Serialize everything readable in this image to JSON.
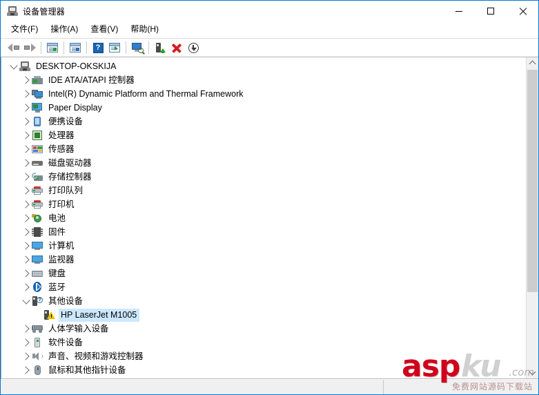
{
  "window": {
    "title": "设备管理器",
    "icon": "device-manager-icon",
    "border_color": "#0078d7",
    "caption": {
      "minimize": "—",
      "maximize": "□",
      "close": "✕"
    }
  },
  "menubar": {
    "items": [
      {
        "label": "文件(F)",
        "name": "menu-file"
      },
      {
        "label": "操作(A)",
        "name": "menu-action"
      },
      {
        "label": "查看(V)",
        "name": "menu-view"
      },
      {
        "label": "帮助(H)",
        "name": "menu-help"
      }
    ]
  },
  "toolbar": {
    "buttons": [
      {
        "name": "back-arrow-icon",
        "tip": "后退"
      },
      {
        "name": "forward-arrow-icon",
        "tip": "前进"
      },
      {
        "name": "show-hide-console-tree-icon",
        "tip": "显示/隐藏控制台树"
      },
      {
        "name": "properties-icon",
        "tip": "属性"
      },
      {
        "name": "help-icon",
        "tip": "帮助"
      },
      {
        "name": "action-menu-icon",
        "tip": "操作"
      },
      {
        "name": "scan-hardware-changes-icon",
        "tip": "扫描检测硬件改动"
      },
      {
        "name": "update-driver-icon",
        "tip": "更新驱动程序"
      },
      {
        "name": "uninstall-device-icon",
        "tip": "卸载设备"
      },
      {
        "name": "disable-device-icon",
        "tip": "禁用设备"
      }
    ]
  },
  "tree": {
    "root": {
      "label": "DESKTOP-OKSKIJA",
      "icon": "computer-icon",
      "expanded": true,
      "level": 0
    },
    "items": [
      {
        "label": "IDE ATA/ATAPI 控制器",
        "icon": "ide-controller-icon",
        "expanded": false,
        "level": 1,
        "selected": false
      },
      {
        "label": "Intel(R) Dynamic Platform and Thermal Framework",
        "icon": "intel-framework-icon",
        "expanded": false,
        "level": 1,
        "selected": false
      },
      {
        "label": "Paper Display",
        "icon": "display-adapter-icon",
        "expanded": false,
        "level": 1,
        "selected": false
      },
      {
        "label": "便携设备",
        "icon": "portable-device-icon",
        "expanded": false,
        "level": 1,
        "selected": false
      },
      {
        "label": "处理器",
        "icon": "processor-icon",
        "expanded": false,
        "level": 1,
        "selected": false
      },
      {
        "label": "传感器",
        "icon": "sensor-icon",
        "expanded": false,
        "level": 1,
        "selected": false
      },
      {
        "label": "磁盘驱动器",
        "icon": "disk-drive-icon",
        "expanded": false,
        "level": 1,
        "selected": false
      },
      {
        "label": "存储控制器",
        "icon": "storage-controller-icon",
        "expanded": false,
        "level": 1,
        "selected": false
      },
      {
        "label": "打印队列",
        "icon": "print-queue-icon",
        "expanded": false,
        "level": 1,
        "selected": false
      },
      {
        "label": "打印机",
        "icon": "printer-icon",
        "expanded": false,
        "level": 1,
        "selected": false
      },
      {
        "label": "电池",
        "icon": "battery-icon",
        "expanded": false,
        "level": 1,
        "selected": false
      },
      {
        "label": "固件",
        "icon": "firmware-icon",
        "expanded": false,
        "level": 1,
        "selected": false
      },
      {
        "label": "计算机",
        "icon": "computer-node-icon",
        "expanded": false,
        "level": 1,
        "selected": false
      },
      {
        "label": "监视器",
        "icon": "monitor-icon",
        "expanded": false,
        "level": 1,
        "selected": false
      },
      {
        "label": "键盘",
        "icon": "keyboard-icon",
        "expanded": false,
        "level": 1,
        "selected": false
      },
      {
        "label": "蓝牙",
        "icon": "bluetooth-icon",
        "expanded": false,
        "level": 1,
        "selected": false
      },
      {
        "label": "其他设备",
        "icon": "other-devices-icon",
        "expanded": true,
        "level": 1,
        "selected": false
      },
      {
        "label": "HP LaserJet M1005",
        "icon": "unknown-device-warning-icon",
        "expanded": null,
        "level": 2,
        "selected": true
      },
      {
        "label": "人体学输入设备",
        "icon": "hid-icon",
        "expanded": false,
        "level": 1,
        "selected": false
      },
      {
        "label": "软件设备",
        "icon": "software-device-icon",
        "expanded": false,
        "level": 1,
        "selected": false
      },
      {
        "label": "声音、视频和游戏控制器",
        "icon": "sound-video-game-icon",
        "expanded": false,
        "level": 1,
        "selected": false
      },
      {
        "label": "鼠标和其他指针设备",
        "icon": "mouse-icon",
        "expanded": false,
        "level": 1,
        "selected": false
      }
    ],
    "selection_color": "#cce8ff"
  },
  "scrollbar": {
    "up_arrow": "▲",
    "down_arrow": "▼",
    "thumb_top_pct": 3,
    "thumb_height_pct": 72
  },
  "statusbar": {
    "left_text": "",
    "right_text": ""
  },
  "watermark": {
    "brand_red": "asp",
    "brand_gray": "ku",
    "domain": ".com",
    "subtitle": "免费网站源码下载站",
    "red": "#d0021b"
  }
}
